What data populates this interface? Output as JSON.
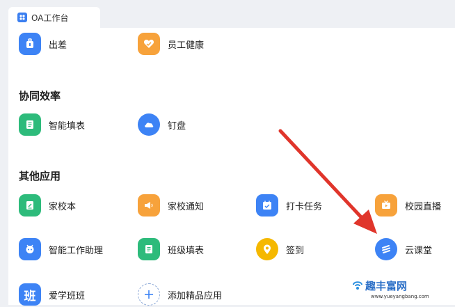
{
  "tab": {
    "label": "OA工作台",
    "icon": "apps-icon"
  },
  "sections": {
    "top": {
      "apps": [
        {
          "label": "出差",
          "icon": "luggage-icon",
          "color": "#3d83f5"
        },
        {
          "label": "员工健康",
          "icon": "heart-icon",
          "color": "#f7a23b"
        }
      ]
    },
    "collab": {
      "title": "协同效率",
      "apps": [
        {
          "label": "智能填表",
          "icon": "form-icon",
          "color": "#2dbb7b"
        },
        {
          "label": "钉盘",
          "icon": "cloud-icon",
          "color": "#3d83f5"
        }
      ]
    },
    "other": {
      "title": "其他应用",
      "apps": [
        {
          "label": "家校本",
          "icon": "notebook-icon",
          "color": "#2dbb7b"
        },
        {
          "label": "家校通知",
          "icon": "megaphone-icon",
          "color": "#f7a23b"
        },
        {
          "label": "打卡任务",
          "icon": "calendar-check-icon",
          "color": "#3d83f5"
        },
        {
          "label": "校园直播",
          "icon": "live-tv-icon",
          "color": "#f7a23b"
        },
        {
          "label": "智能工作助理",
          "icon": "robot-icon",
          "color": "#3d83f5"
        },
        {
          "label": "班级填表",
          "icon": "form-icon",
          "color": "#2dbb7b"
        },
        {
          "label": "签到",
          "icon": "location-pin-icon",
          "color": "#f5b800"
        },
        {
          "label": "云课堂",
          "icon": "stripes-icon",
          "color": "#3d83f5"
        },
        {
          "label": "爱学班班",
          "icon": "text-badge-icon",
          "color": "#3d83f5",
          "glyph": "班"
        }
      ]
    },
    "add": {
      "label": "添加精品应用",
      "icon": "plus-icon"
    }
  },
  "watermark": {
    "title": "趣丰富网",
    "url": "www.yueyangbang.com"
  },
  "colors": {
    "accent": "#3d83f5",
    "arrow": "#e0352b"
  }
}
